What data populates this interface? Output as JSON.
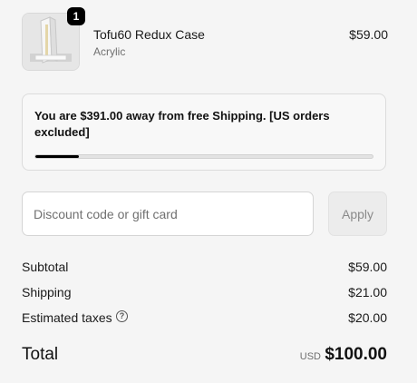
{
  "line_item": {
    "quantity": "1",
    "name": "Tofu60 Redux Case",
    "variant": "Acrylic",
    "price": "$59.00"
  },
  "free_shipping": {
    "message": "You are $391.00 away from free Shipping. [US orders excluded]",
    "progress_fraction": 0.13
  },
  "discount": {
    "placeholder": "Discount code or gift card",
    "apply_label": "Apply"
  },
  "summary": {
    "subtotal_label": "Subtotal",
    "subtotal_value": "$59.00",
    "shipping_label": "Shipping",
    "shipping_value": "$21.00",
    "taxes_label": "Estimated taxes",
    "taxes_value": "$20.00",
    "total_label": "Total",
    "currency": "USD",
    "total_value": "$100.00"
  },
  "icons": {
    "help": "question-circle-icon"
  }
}
